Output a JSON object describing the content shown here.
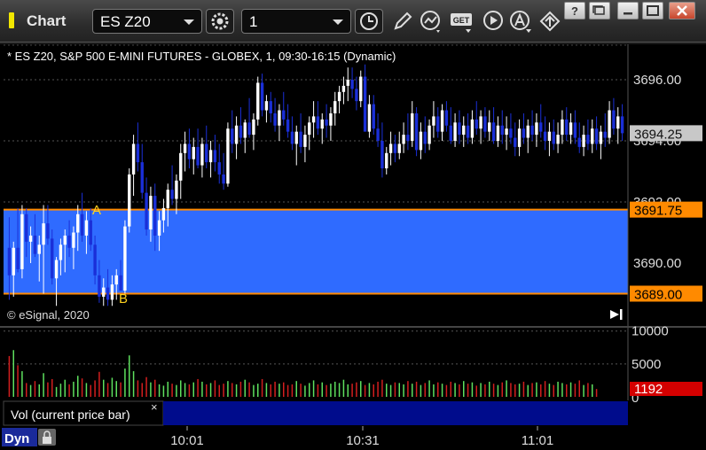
{
  "window": {
    "title": "Chart",
    "symbol": "ES Z20",
    "interval": "1",
    "buttons": {
      "minimize": "–",
      "restore": "▭",
      "maximize": "□",
      "close": "✕"
    },
    "tool_icons": [
      "settings-icon",
      "clock-icon",
      "draw-pencil-icon",
      "study-icon",
      "get-icon",
      "play-icon",
      "alert-icon",
      "trade-arrow-icon"
    ],
    "get_label": "GET"
  },
  "chart_header": "* ES Z20, S&P 500 E-MINI FUTURES - GLOBEX, 1, 09:30-16:15 (Dynamic)",
  "copyright": "© eSignal, 2020",
  "price_panel": {
    "axis_labels": [
      "3696.00",
      "3694.00",
      "3692.00",
      "3690.00"
    ],
    "last_price": "3694.25",
    "zone_top_price": "3691.75",
    "zone_bottom_price": "3689.00",
    "zone_label_top": "A",
    "zone_label_bottom": "B",
    "colors": {
      "zone_fill": "#2f6bff",
      "zone_line": "#ff8a00",
      "up_bar": "#ffffff",
      "down_bar": "#1a2fd8",
      "last_price_bg": "#c8c8c8"
    }
  },
  "volume_panel": {
    "axis_labels": [
      "10000",
      "5000",
      "0"
    ],
    "current_volume": "1192",
    "legend": "Vol (current price bar)",
    "legend_close": "×",
    "colors": {
      "up": "#5ee05e",
      "down": "#d21e1e",
      "current_bg": "#d40000"
    }
  },
  "time_axis": {
    "labels": [
      "10:01",
      "10:31",
      "11:01"
    ],
    "dyn_label": "Dyn"
  },
  "chart_data": {
    "type": "candlestick",
    "y_range": [
      3688.3,
      3697.2
    ],
    "volume_range": [
      0,
      10500
    ],
    "bars": [
      [
        3690.5,
        3691.5,
        3688.8,
        3689.6
      ],
      [
        3689.6,
        3690.7,
        3688.9,
        3690.5
      ],
      [
        3690.5,
        3691.8,
        3689.7,
        3689.8
      ],
      [
        3689.8,
        3691.9,
        3689.5,
        3691.6
      ],
      [
        3691.6,
        3691.8,
        3690.2,
        3690.7
      ],
      [
        3690.7,
        3691.2,
        3690.0,
        3690.9
      ],
      [
        3690.9,
        3691.6,
        3690.2,
        3690.3
      ],
      [
        3690.3,
        3690.9,
        3689.4,
        3690.6
      ],
      [
        3690.6,
        3691.9,
        3689.0,
        3691.3
      ],
      [
        3691.3,
        3691.9,
        3690.6,
        3690.8
      ],
      [
        3690.8,
        3691.1,
        3689.3,
        3689.5
      ],
      [
        3689.5,
        3690.2,
        3688.6,
        3690.1
      ],
      [
        3690.1,
        3690.8,
        3689.6,
        3690.6
      ],
      [
        3690.6,
        3691.1,
        3689.7,
        3690.9
      ],
      [
        3690.9,
        3691.4,
        3690.2,
        3690.5
      ],
      [
        3690.5,
        3691.2,
        3689.8,
        3691.0
      ],
      [
        3691.0,
        3691.9,
        3690.4,
        3691.6
      ],
      [
        3691.6,
        3692.3,
        3690.7,
        3690.9
      ],
      [
        3690.9,
        3691.7,
        3690.3,
        3691.4
      ],
      [
        3691.4,
        3691.8,
        3690.4,
        3690.6
      ],
      [
        3690.6,
        3690.9,
        3689.3,
        3689.6
      ],
      [
        3689.6,
        3690.1,
        3688.7,
        3688.9
      ],
      [
        3688.9,
        3689.5,
        3688.6,
        3689.2
      ],
      [
        3689.2,
        3689.8,
        3688.6,
        3688.8
      ],
      [
        3688.8,
        3689.6,
        3688.6,
        3689.3
      ],
      [
        3689.3,
        3689.8,
        3688.8,
        3689.6
      ],
      [
        3689.6,
        3690.1,
        3689.1,
        3689.1
      ],
      [
        3689.1,
        3691.4,
        3689.0,
        3691.2
      ],
      [
        3691.2,
        3693.1,
        3691.0,
        3692.9
      ],
      [
        3692.9,
        3694.2,
        3692.2,
        3693.9
      ],
      [
        3693.9,
        3694.6,
        3693.0,
        3693.3
      ],
      [
        3693.3,
        3693.9,
        3692.1,
        3692.3
      ],
      [
        3692.3,
        3692.8,
        3690.9,
        3691.1
      ],
      [
        3691.1,
        3692.5,
        3690.7,
        3692.2
      ],
      [
        3692.2,
        3692.6,
        3690.4,
        3690.9
      ],
      [
        3690.9,
        3691.7,
        3690.4,
        3691.4
      ],
      [
        3691.4,
        3692.1,
        3691.0,
        3691.8
      ],
      [
        3691.8,
        3692.6,
        3691.2,
        3692.4
      ],
      [
        3692.4,
        3693.2,
        3691.9,
        3692.1
      ],
      [
        3692.1,
        3692.9,
        3691.6,
        3692.7
      ],
      [
        3692.7,
        3693.9,
        3692.1,
        3693.6
      ],
      [
        3693.6,
        3694.3,
        3693.0,
        3693.9
      ],
      [
        3693.9,
        3694.4,
        3693.1,
        3693.4
      ],
      [
        3693.4,
        3694.1,
        3692.9,
        3693.8
      ],
      [
        3693.8,
        3694.4,
        3693.1,
        3693.2
      ],
      [
        3693.2,
        3694.1,
        3692.8,
        3693.9
      ],
      [
        3693.9,
        3694.5,
        3693.1,
        3693.3
      ],
      [
        3693.3,
        3694.0,
        3692.8,
        3693.7
      ],
      [
        3693.7,
        3694.2,
        3693.0,
        3693.3
      ],
      [
        3693.3,
        3693.9,
        3692.6,
        3692.9
      ],
      [
        3692.9,
        3693.6,
        3692.4,
        3692.6
      ],
      [
        3692.6,
        3694.6,
        3692.5,
        3694.4
      ],
      [
        3694.4,
        3695.0,
        3693.6,
        3693.9
      ],
      [
        3693.9,
        3694.8,
        3693.4,
        3694.5
      ],
      [
        3694.5,
        3695.1,
        3693.9,
        3694.1
      ],
      [
        3694.1,
        3694.7,
        3693.6,
        3694.6
      ],
      [
        3694.6,
        3695.4,
        3694.1,
        3694.2
      ],
      [
        3694.2,
        3694.9,
        3693.7,
        3694.7
      ],
      [
        3694.7,
        3696.1,
        3694.5,
        3695.9
      ],
      [
        3695.9,
        3696.2,
        3694.8,
        3695.0
      ],
      [
        3695.0,
        3695.5,
        3694.6,
        3695.3
      ],
      [
        3695.3,
        3695.6,
        3694.6,
        3694.9
      ],
      [
        3694.9,
        3695.4,
        3694.3,
        3694.5
      ],
      [
        3694.5,
        3695.2,
        3694.0,
        3695.0
      ],
      [
        3695.0,
        3695.6,
        3694.5,
        3694.7
      ],
      [
        3694.7,
        3695.2,
        3694.1,
        3694.3
      ],
      [
        3694.3,
        3694.8,
        3693.7,
        3693.9
      ],
      [
        3693.9,
        3694.5,
        3693.2,
        3694.3
      ],
      [
        3694.3,
        3694.9,
        3693.6,
        3693.8
      ],
      [
        3693.8,
        3694.5,
        3693.3,
        3694.2
      ],
      [
        3694.2,
        3694.8,
        3693.7,
        3694.6
      ],
      [
        3694.6,
        3695.3,
        3694.1,
        3694.8
      ],
      [
        3694.8,
        3695.3,
        3694.2,
        3694.4
      ],
      [
        3694.4,
        3694.9,
        3693.9,
        3694.7
      ],
      [
        3694.7,
        3695.2,
        3694.1,
        3694.5
      ],
      [
        3694.5,
        3695.1,
        3694.0,
        3694.9
      ],
      [
        3694.9,
        3695.6,
        3694.5,
        3695.3
      ],
      [
        3695.3,
        3695.8,
        3694.9,
        3695.6
      ],
      [
        3695.6,
        3696.1,
        3695.2,
        3695.8
      ],
      [
        3695.8,
        3696.4,
        3695.3,
        3696.0
      ],
      [
        3696.0,
        3696.4,
        3695.4,
        3695.7
      ],
      [
        3695.7,
        3696.1,
        3695.0,
        3695.3
      ],
      [
        3695.3,
        3696.3,
        3695.1,
        3696.1
      ],
      [
        3696.1,
        3696.5,
        3695.1,
        3694.3
      ],
      [
        3694.3,
        3695.5,
        3694.1,
        3695.2
      ],
      [
        3695.2,
        3695.5,
        3694.2,
        3694.4
      ],
      [
        3694.4,
        3694.9,
        3693.8,
        3694.0
      ],
      [
        3694.0,
        3694.6,
        3692.8,
        3693.1
      ],
      [
        3693.1,
        3693.8,
        3692.9,
        3693.6
      ],
      [
        3693.6,
        3694.3,
        3693.2,
        3693.9
      ],
      [
        3693.9,
        3694.2,
        3693.3,
        3693.6
      ],
      [
        3693.6,
        3694.3,
        3693.4,
        3693.9
      ],
      [
        3693.9,
        3694.6,
        3693.6,
        3694.2
      ],
      [
        3694.2,
        3694.9,
        3693.7,
        3694.0
      ],
      [
        3694.0,
        3695.3,
        3693.8,
        3694.9
      ],
      [
        3694.9,
        3695.1,
        3693.5,
        3693.7
      ],
      [
        3693.7,
        3694.6,
        3693.4,
        3694.3
      ],
      [
        3694.3,
        3694.8,
        3693.6,
        3693.9
      ],
      [
        3693.9,
        3694.7,
        3693.7,
        3694.5
      ],
      [
        3694.5,
        3695.3,
        3694.1,
        3694.8
      ],
      [
        3694.8,
        3695.1,
        3694.1,
        3694.3
      ],
      [
        3694.3,
        3695.2,
        3694.0,
        3695.0
      ],
      [
        3695.0,
        3695.3,
        3694.3,
        3694.5
      ],
      [
        3694.5,
        3695.1,
        3693.9,
        3694.0
      ],
      [
        3694.0,
        3694.9,
        3693.8,
        3694.6
      ],
      [
        3694.6,
        3695.0,
        3693.9,
        3694.2
      ],
      [
        3694.2,
        3694.8,
        3693.8,
        3694.5
      ],
      [
        3694.5,
        3694.9,
        3693.9,
        3694.1
      ],
      [
        3694.1,
        3695.0,
        3693.9,
        3694.7
      ],
      [
        3694.7,
        3695.3,
        3694.2,
        3694.4
      ],
      [
        3694.4,
        3695.0,
        3693.9,
        3694.8
      ],
      [
        3694.8,
        3695.1,
        3694.1,
        3694.3
      ],
      [
        3694.3,
        3695.0,
        3694.0,
        3694.6
      ],
      [
        3694.6,
        3695.1,
        3693.9,
        3694.0
      ],
      [
        3694.0,
        3694.8,
        3693.8,
        3694.5
      ],
      [
        3694.5,
        3695.0,
        3693.9,
        3694.2
      ],
      [
        3694.2,
        3694.8,
        3693.7,
        3694.4
      ],
      [
        3694.4,
        3694.9,
        3693.9,
        3694.1
      ],
      [
        3694.1,
        3694.6,
        3693.5,
        3693.8
      ],
      [
        3693.8,
        3694.7,
        3693.5,
        3694.4
      ],
      [
        3694.4,
        3694.9,
        3693.9,
        3694.1
      ],
      [
        3694.1,
        3694.7,
        3693.6,
        3694.5
      ],
      [
        3694.5,
        3695.0,
        3694.0,
        3694.2
      ],
      [
        3694.2,
        3694.9,
        3693.8,
        3694.6
      ],
      [
        3694.6,
        3695.2,
        3694.1,
        3694.3
      ],
      [
        3694.3,
        3694.8,
        3693.7,
        3694.0
      ],
      [
        3694.0,
        3694.6,
        3693.5,
        3694.3
      ],
      [
        3694.3,
        3694.7,
        3693.7,
        3693.9
      ],
      [
        3693.9,
        3694.6,
        3693.6,
        3694.2
      ],
      [
        3694.2,
        3695.0,
        3693.9,
        3694.7
      ],
      [
        3694.7,
        3695.1,
        3694.0,
        3694.2
      ],
      [
        3694.2,
        3694.9,
        3693.9,
        3694.6
      ],
      [
        3694.6,
        3695.0,
        3693.9,
        3694.1
      ],
      [
        3694.1,
        3694.6,
        3693.6,
        3693.8
      ],
      [
        3693.8,
        3694.5,
        3693.5,
        3694.2
      ],
      [
        3694.2,
        3694.7,
        3693.7,
        3693.9
      ],
      [
        3693.9,
        3694.7,
        3693.6,
        3694.4
      ],
      [
        3694.4,
        3694.8,
        3693.7,
        3693.9
      ],
      [
        3693.9,
        3694.5,
        3693.4,
        3694.3
      ],
      [
        3694.3,
        3694.9,
        3693.8,
        3694.1
      ],
      [
        3694.1,
        3695.3,
        3693.9,
        3695.0
      ],
      [
        3695.0,
        3695.4,
        3694.2,
        3694.4
      ],
      [
        3694.4,
        3695.1,
        3693.9,
        3694.8
      ],
      [
        3694.8,
        3695.2,
        3694.0,
        3694.25
      ]
    ],
    "volumes": [
      6200,
      7100,
      4800,
      3900,
      2100,
      1800,
      2400,
      1900,
      3600,
      2200,
      2700,
      1500,
      2000,
      2600,
      1900,
      2300,
      3200,
      2800,
      2100,
      1800,
      2500,
      3800,
      2600,
      2100,
      2900,
      2400,
      2200,
      4300,
      6300,
      3900,
      2500,
      2100,
      3000,
      2200,
      2600,
      1900,
      1700,
      2300,
      2000,
      1800,
      2500,
      2100,
      1900,
      2200,
      2700,
      2300,
      1900,
      2100,
      2500,
      1800,
      2000,
      2400,
      2100,
      1900,
      2300,
      2600,
      2200,
      1800,
      2000,
      2700,
      2100,
      1900,
      2300,
      2000,
      2200,
      1800,
      1900,
      2400,
      2000,
      1700,
      2100,
      2500,
      1900,
      2200,
      1800,
      2000,
      2300,
      2100,
      2600,
      1900,
      2000,
      2200,
      2400,
      1800,
      2100,
      1900,
      2300,
      2600,
      2000,
      1800,
      2200,
      2100,
      1900,
      2400,
      2000,
      2300,
      1800,
      2100,
      2500,
      1900,
      2200,
      2000,
      1800,
      2300,
      2100,
      1900,
      2400,
      2000,
      2200,
      1700,
      2100,
      1900,
      2300,
      2000,
      1800,
      2200,
      2500,
      2100,
      1900,
      2000,
      2300,
      1800,
      2100,
      2200,
      1900,
      2400,
      2000,
      1800,
      2300,
      2100,
      1900,
      2200,
      2000,
      2500,
      1800,
      2100,
      1900,
      1192
    ],
    "zone": {
      "top": 3691.75,
      "bottom": 3689.0
    },
    "last": 3694.25
  }
}
